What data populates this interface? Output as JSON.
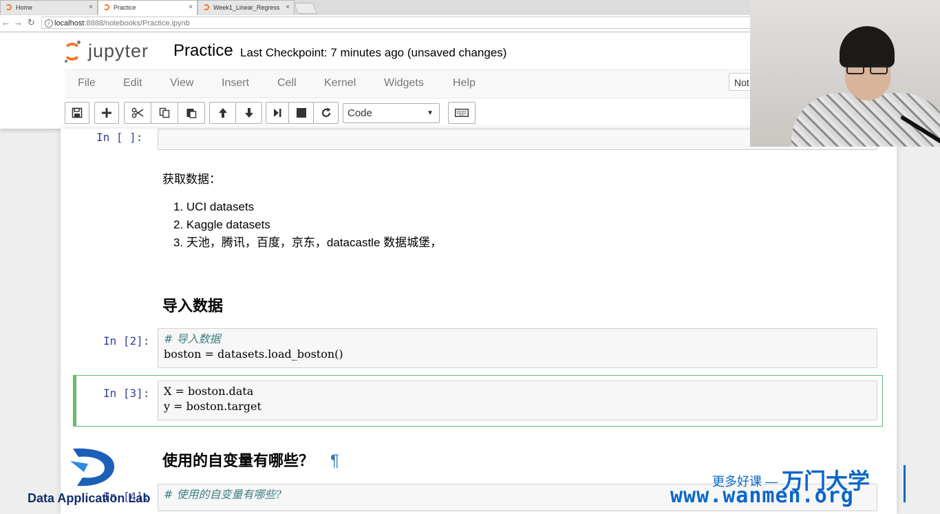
{
  "browser": {
    "tabs": [
      {
        "title": "Home",
        "active": false
      },
      {
        "title": "Practice",
        "active": true
      },
      {
        "title": "Week1_Linear_Regress",
        "active": false
      }
    ],
    "url_host": "localhost",
    "url_path": ":8888/notebooks/Practice.ipynb"
  },
  "header": {
    "logo_text": "jupyter",
    "notebook_name": "Practice",
    "checkpoint": "Last Checkpoint: 7 minutes ago (unsaved changes)",
    "kernel_indicator": "Not"
  },
  "menu": [
    "File",
    "Edit",
    "View",
    "Insert",
    "Cell",
    "Kernel",
    "Widgets",
    "Help"
  ],
  "toolbar": {
    "buttons": [
      "save-icon",
      "plus-icon",
      "cut-icon",
      "copy-icon",
      "paste-icon",
      "arrow-up-icon",
      "arrow-down-icon",
      "run-icon",
      "stop-icon",
      "restart-icon",
      "keyboard-icon"
    ],
    "cell_type": "Code"
  },
  "cells": {
    "empty": {
      "prompt": "In [ ]:"
    },
    "md_fetch": {
      "intro": "获取数据：",
      "items": [
        "1. UCI datasets",
        "2. Kaggle datasets",
        "3. 天池，腾讯，百度，京东，datacastle 数据城堡，"
      ]
    },
    "md_import": {
      "heading": "导入数据"
    },
    "code2": {
      "prompt": "In [2]:",
      "comment": "# 导入数据",
      "line": "boston = datasets.load_boston()"
    },
    "code3": {
      "prompt": "In [3]:",
      "line1": "X = boston.data",
      "line2": "y = boston.target"
    },
    "md_vars": {
      "heading": "使用的自变量有哪些？",
      "anchor": "¶"
    },
    "code4": {
      "prompt": "In [4]:",
      "comment": "# 使用的自变量有哪些?"
    }
  },
  "watermarks": {
    "lab_name": "Data Application Lab",
    "promo_small": "更多好课 —",
    "promo_big": "万门大学",
    "url": "www.wanmen.org"
  },
  "colors": {
    "prompt": "#303f9f",
    "selected_cell": "#66bb6a",
    "jupyter_orange": "#f37626",
    "watermark": "#0a67c8"
  }
}
